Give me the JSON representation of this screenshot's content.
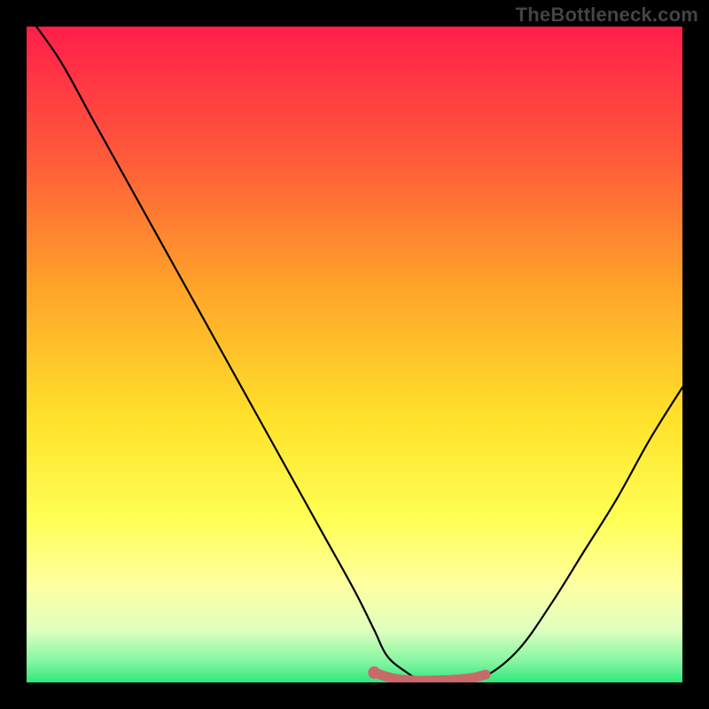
{
  "attribution": {
    "watermark": "TheBottleneck.com"
  },
  "colors": {
    "frame": "#000000",
    "curve": "#000000",
    "highlight": "#C96A6A",
    "highlight_dot": "#C96A6A",
    "gradient_stops": [
      {
        "offset": 0.0,
        "color": "#FF1E4A"
      },
      {
        "offset": 0.2,
        "color": "#FF5A3A"
      },
      {
        "offset": 0.4,
        "color": "#FFA52A"
      },
      {
        "offset": 0.6,
        "color": "#FFE22A"
      },
      {
        "offset": 0.75,
        "color": "#FFFF55"
      },
      {
        "offset": 0.85,
        "color": "#FFFFA0"
      },
      {
        "offset": 0.92,
        "color": "#E0FFC0"
      },
      {
        "offset": 0.97,
        "color": "#80F5A0"
      },
      {
        "offset": 1.0,
        "color": "#2DE87A"
      }
    ]
  },
  "chart_data": {
    "type": "line",
    "title": "",
    "xlabel": "",
    "ylabel": "",
    "xlim": [
      0,
      100
    ],
    "ylim": [
      0,
      100
    ],
    "grid": false,
    "series": [
      {
        "name": "bottleneck-curve",
        "x": [
          0,
          5,
          10,
          15,
          20,
          25,
          30,
          35,
          40,
          45,
          50,
          53,
          55,
          58,
          60,
          63,
          66,
          70,
          75,
          80,
          85,
          90,
          95,
          100
        ],
        "values": [
          102,
          95,
          86,
          77,
          68,
          59,
          50,
          41,
          32,
          23,
          14,
          8,
          4,
          1.5,
          0.5,
          0.3,
          0.4,
          1,
          5,
          12,
          20,
          28,
          37,
          45
        ]
      },
      {
        "name": "optimal-highlight",
        "x": [
          53,
          56,
          59,
          62,
          65,
          68,
          70
        ],
        "values": [
          1.5,
          0.6,
          0.3,
          0.3,
          0.4,
          0.7,
          1.2
        ]
      }
    ],
    "annotations": [
      {
        "name": "optimal-point",
        "x": 53,
        "y": 1.5
      }
    ]
  }
}
